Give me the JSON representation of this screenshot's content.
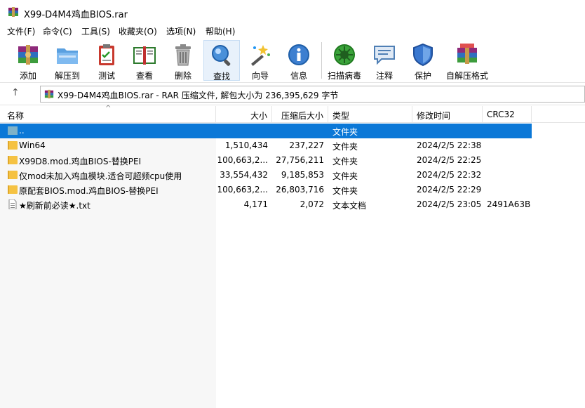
{
  "window": {
    "title": "X99-D4M4鸡血BIOS.rar"
  },
  "menu": [
    "文件(F)",
    "命令(C)",
    "工具(S)",
    "收藏夹(O)",
    "选项(N)",
    "帮助(H)"
  ],
  "toolbar": [
    {
      "label": "添加",
      "icon": "add-archive-icon"
    },
    {
      "label": "解压到",
      "icon": "extract-folder-icon"
    },
    {
      "label": "测试",
      "icon": "test-clipboard-icon"
    },
    {
      "label": "查看",
      "icon": "view-book-icon"
    },
    {
      "label": "删除",
      "icon": "trash-icon"
    },
    {
      "label": "查找",
      "icon": "find-magnifier-icon"
    },
    {
      "label": "向导",
      "icon": "wizard-wand-icon"
    },
    {
      "label": "信息",
      "icon": "info-icon"
    },
    {
      "label": "扫描病毒",
      "icon": "virus-scan-icon"
    },
    {
      "label": "注释",
      "icon": "comment-icon"
    },
    {
      "label": "保护",
      "icon": "shield-icon"
    },
    {
      "label": "自解压格式",
      "icon": "sfx-archive-icon"
    }
  ],
  "address": {
    "text": "X99-D4M4鸡血BIOS.rar - RAR 压缩文件, 解包大小为 236,395,629 字节"
  },
  "columns": {
    "name": "名称",
    "size": "大小",
    "packed": "压缩后大小",
    "type": "类型",
    "modified": "修改时间",
    "crc": "CRC32"
  },
  "files": [
    {
      "name": "..",
      "size": "",
      "packed": "",
      "type": "文件夹",
      "modified": "",
      "crc": "",
      "icon": "parent-folder-icon",
      "selected": true
    },
    {
      "name": "Win64",
      "size": "1,510,434",
      "packed": "237,227",
      "type": "文件夹",
      "modified": "2024/2/5 22:38",
      "crc": "",
      "icon": "folder-icon"
    },
    {
      "name": "X99D8.mod.鸡血BIOS-替换PEI",
      "size": "100,663,2...",
      "packed": "27,756,211",
      "type": "文件夹",
      "modified": "2024/2/5 22:25",
      "crc": "",
      "icon": "folder-icon"
    },
    {
      "name": "仅mod未加入鸡血模块.适合可超频cpu使用",
      "size": "33,554,432",
      "packed": "9,185,853",
      "type": "文件夹",
      "modified": "2024/2/5 22:32",
      "crc": "",
      "icon": "folder-icon"
    },
    {
      "name": "原配套BIOS.mod.鸡血BIOS-替换PEI",
      "size": "100,663,2...",
      "packed": "26,803,716",
      "type": "文件夹",
      "modified": "2024/2/5 22:29",
      "crc": "",
      "icon": "folder-icon"
    },
    {
      "name": "★刷新前必读★.txt",
      "size": "4,171",
      "packed": "2,072",
      "type": "文本文档",
      "modified": "2024/2/5 23:05",
      "crc": "2491A63B",
      "icon": "text-file-icon"
    }
  ],
  "colors": {
    "selection": "#0b78d7",
    "folder": "#f5c242"
  }
}
